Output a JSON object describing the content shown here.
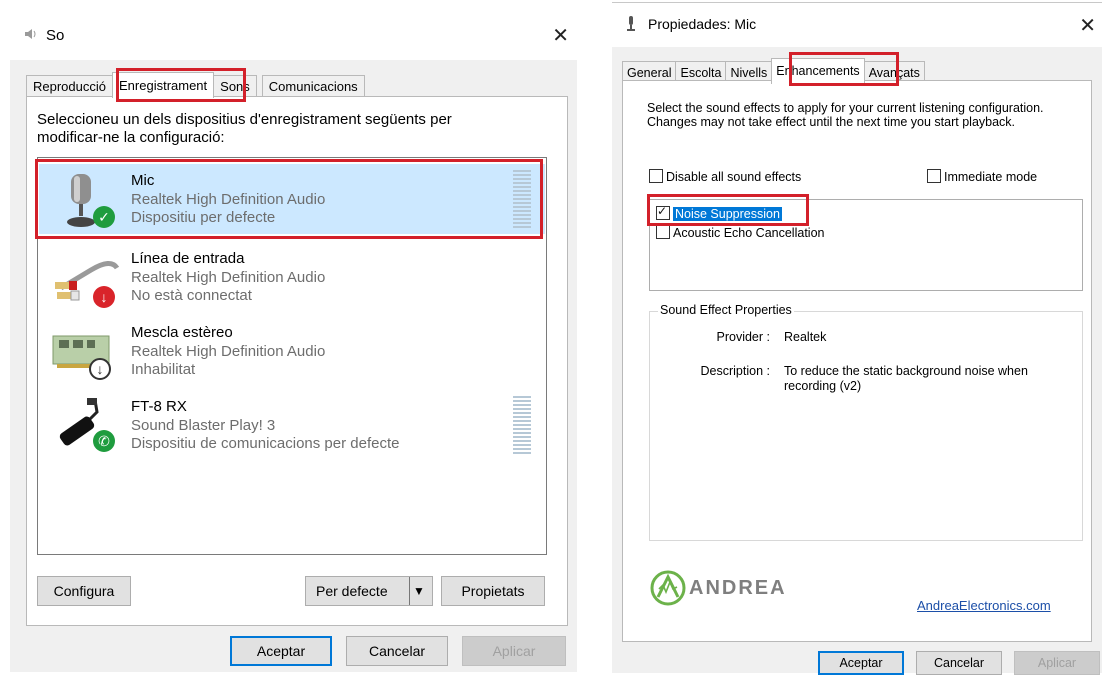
{
  "left_dialog": {
    "title": "So",
    "tabs": [
      "Reproducció",
      "Enregistrament",
      "Sons",
      "Comunicacions"
    ],
    "active_tab": "Enregistrament",
    "instruction": "Seleccioneu un dels dispositius d'enregistrament següents per modificar-ne la configuració:",
    "devices": [
      {
        "name": "Mic",
        "driver": "Realtek High Definition Audio",
        "status": "Dispositiu per defecte",
        "icon": "microphone-icon",
        "badge": "check-badge-icon",
        "selected": true,
        "level_meter": true
      },
      {
        "name": "Línea de entrada",
        "driver": "Realtek High Definition Audio",
        "status": "No està connectat",
        "icon": "rca-cable-icon",
        "badge": "red-down-arrow-badge-icon",
        "selected": false,
        "level_meter": false
      },
      {
        "name": "Mescla estèreo",
        "driver": "Realtek High Definition Audio",
        "status": "Inhabilitat",
        "icon": "sound-card-icon",
        "badge": "disabled-down-arrow-badge-icon",
        "selected": false,
        "level_meter": false
      },
      {
        "name": "FT-8 RX",
        "driver": "Sound Blaster Play! 3",
        "status": "Dispositiu de comunicacions per defecte",
        "icon": "usb-adapter-icon",
        "badge": "phone-badge-icon",
        "selected": false,
        "level_meter": true
      }
    ],
    "buttons": {
      "configure": "Configura",
      "set_default": "Per defecte",
      "properties": "Propietats"
    },
    "footer": {
      "ok": "Aceptar",
      "cancel": "Cancelar",
      "apply": "Aplicar"
    }
  },
  "right_dialog": {
    "title": "Propiedades: Mic",
    "tabs": [
      "General",
      "Escolta",
      "Nivells",
      "Enhancements",
      "Avançats"
    ],
    "active_tab": "Enhancements",
    "instruction": "Select the sound effects to apply for your current listening configuration. Changes may not take effect until the next time you start playback.",
    "disable_all": {
      "label": "Disable all sound effects",
      "checked": false
    },
    "immediate_mode": {
      "label": "Immediate mode",
      "checked": false
    },
    "effects": [
      {
        "label": "Noise Suppression",
        "checked": true,
        "selected": true
      },
      {
        "label": "Acoustic Echo Cancellation",
        "checked": false,
        "selected": false
      }
    ],
    "properties_group": {
      "legend": "Sound Effect Properties",
      "provider_label": "Provider :",
      "provider_value": "Realtek",
      "description_label": "Description :",
      "description_value": "To reduce the static background noise when recording (v2)"
    },
    "brand": {
      "logo_text": "ANDREA",
      "link": "AndreaElectronics.com"
    },
    "footer": {
      "ok": "Aceptar",
      "cancel": "Cancelar",
      "apply": "Aplicar"
    }
  },
  "colors": {
    "highlight_box": "#d3202a",
    "selection": "#cce8ff",
    "focus_blue": "#0078d7",
    "badge_green": "#1f9c3e",
    "badge_red": "#d9242a",
    "brand_green": "#6cb24a",
    "brand_gray": "#7f7f7f"
  }
}
